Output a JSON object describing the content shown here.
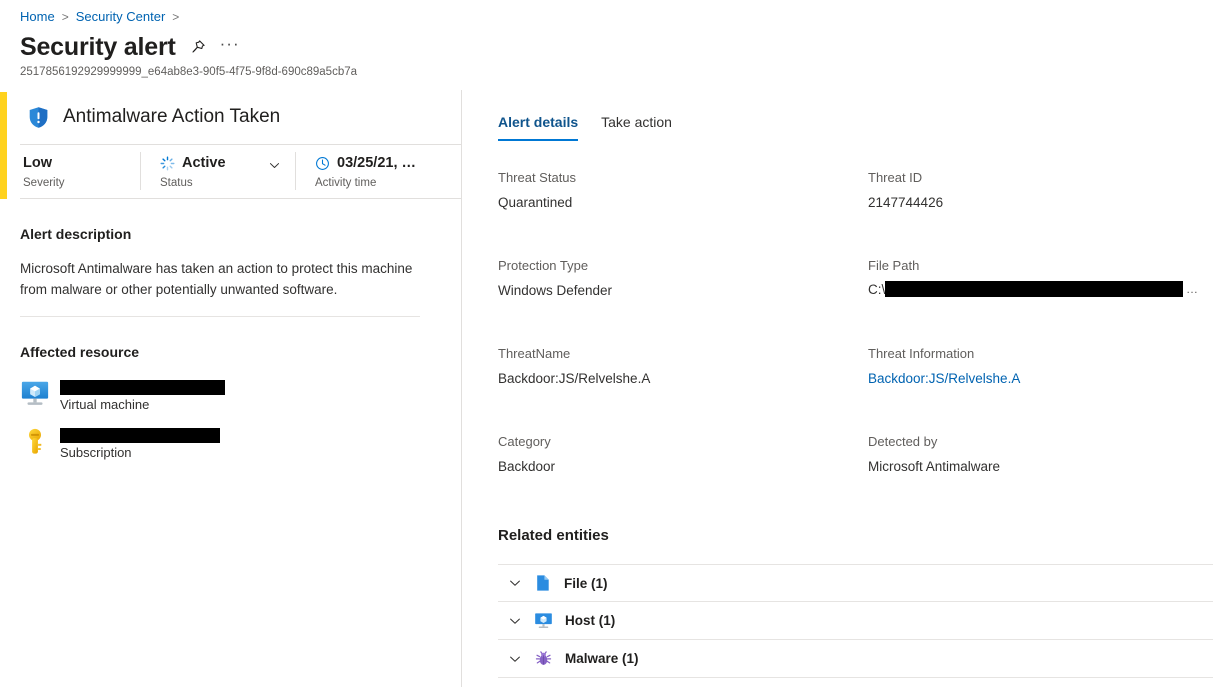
{
  "breadcrumb": {
    "items": [
      {
        "label": "Home",
        "link": true
      },
      {
        "label": "Security Center",
        "link": true
      }
    ],
    "separator": ">"
  },
  "header": {
    "title": "Security alert",
    "pin_icon": "pin-icon",
    "more_icon": "ellipsis-icon",
    "more_label": "···",
    "alert_id": "2517856192929999999_e64ab8e3-90f5-4f75-9f8d-690c89a5cb7a"
  },
  "alert": {
    "name": "Antimalware Action Taken",
    "shield_icon": "shield-alert-icon",
    "severity_color": "#FFD21E",
    "accent_color": "#0078d4",
    "link_color": "#0063b1",
    "meta": [
      {
        "value": "Low",
        "label": "Severity",
        "icon": null
      },
      {
        "value": "Active",
        "label": "Status",
        "icon": "spinner-icon"
      },
      {
        "value": "03/25/21, …",
        "label": "Activity time",
        "icon": "clock-icon"
      }
    ],
    "status_chevron_icon": "chevron-down-icon",
    "description_heading": "Alert description",
    "description_body": "Microsoft Antimalware has taken an action to protect this machine from malware or other potentially unwanted software.",
    "affected_heading": "Affected resource",
    "resources": [
      {
        "type": "Virtual machine",
        "icon": "virtual-machine-icon",
        "name_redacted": true,
        "redact_width": 165
      },
      {
        "type": "Subscription",
        "icon": "key-icon",
        "name_redacted": true,
        "redact_width": 160
      }
    ]
  },
  "tabs": [
    {
      "label": "Alert details",
      "active": true
    },
    {
      "label": "Take action",
      "active": false
    }
  ],
  "details": [
    {
      "label": "Threat Status",
      "value": "Quarantined",
      "link": false
    },
    {
      "label": "Threat ID",
      "value": "2147744426",
      "link": false
    },
    {
      "label": "Protection Type",
      "value": "Windows Defender",
      "link": false
    },
    {
      "label": "File Path",
      "value": "C:\\",
      "link": false,
      "redacted": true,
      "ellipsis": "…"
    },
    {
      "label": "ThreatName",
      "value": "Backdoor:JS/Relvelshe.A",
      "link": false
    },
    {
      "label": "Threat Information",
      "value": "Backdoor:JS/Relvelshe.A",
      "link": true
    },
    {
      "label": "Category",
      "value": "Backdoor",
      "link": false
    },
    {
      "label": "Detected by",
      "value": "Microsoft Antimalware",
      "link": false
    }
  ],
  "related": {
    "heading": "Related entities",
    "entities": [
      {
        "label": "File (1)",
        "icon": "file-icon",
        "chevron": "chevron-down-icon"
      },
      {
        "label": "Host (1)",
        "icon": "host-icon",
        "chevron": "chevron-down-icon"
      },
      {
        "label": "Malware (1)",
        "icon": "malware-bug-icon",
        "chevron": "chevron-down-icon"
      }
    ]
  }
}
